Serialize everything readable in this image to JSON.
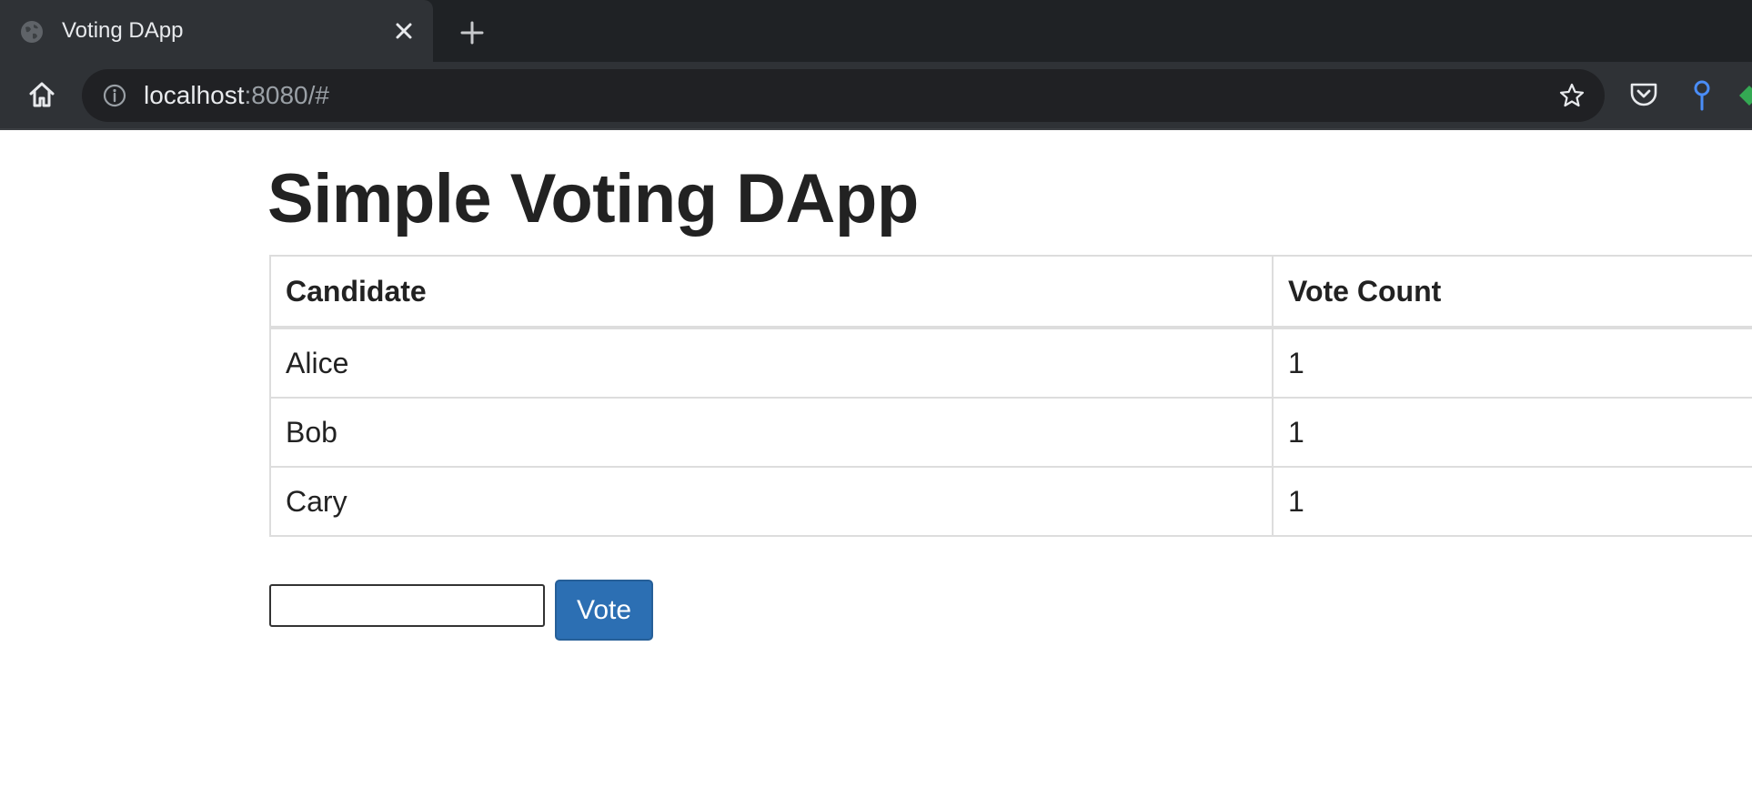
{
  "browser": {
    "tab": {
      "title": "Voting DApp",
      "favicon": "globe-icon",
      "close_icon": "close-icon"
    },
    "new_tab_icon": "plus-icon",
    "toolbar": {
      "home_icon": "home-icon",
      "info_icon": "info-icon",
      "url_host": "localhost",
      "url_rest": ":8080/#",
      "bookmark_icon": "star-icon",
      "extensions": [
        "pocket-icon",
        "key-icon",
        "green-extension-icon"
      ]
    }
  },
  "page": {
    "title": "Simple Voting DApp",
    "table": {
      "headers": [
        "Candidate",
        "Vote Count"
      ],
      "rows": [
        {
          "candidate": "Alice",
          "votes": "1"
        },
        {
          "candidate": "Bob",
          "votes": "1"
        },
        {
          "candidate": "Cary",
          "votes": "1"
        }
      ]
    },
    "input": {
      "value": "",
      "placeholder": ""
    },
    "vote_button": "Vote"
  },
  "colors": {
    "button_bg": "#2c6fb3",
    "tab_bg": "#2f3236",
    "strip_bg": "#1f2225"
  }
}
